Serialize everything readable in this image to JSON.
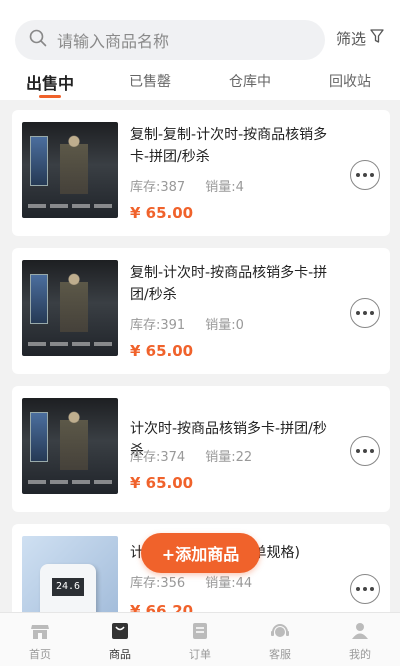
{
  "search": {
    "placeholder": "请输入商品名称"
  },
  "filter": {
    "label": "筛选"
  },
  "tabs": [
    {
      "label": "出售中"
    },
    {
      "label": "已售罄"
    },
    {
      "label": "仓库中"
    },
    {
      "label": "回收站"
    }
  ],
  "labels": {
    "stock": "库存:",
    "sales": "销量:"
  },
  "products": [
    {
      "title": "复制-复制-计次时-按商品核销多卡-拼团/秒杀",
      "stock": "387",
      "sales": "4",
      "price": "¥ 65.00"
    },
    {
      "title": "复制-计次时-按商品核销多卡-拼团/秒杀",
      "stock": "391",
      "sales": "0",
      "price": "¥ 65.00"
    },
    {
      "title": "计次时-按商品核销多卡-拼团/秒杀",
      "stock": "374",
      "sales": "22",
      "price": "¥ 65.00"
    },
    {
      "title": "计次时-按商品核销(单规格)",
      "stock": "356",
      "sales": "44",
      "price": "¥ 66.20",
      "thumb_text": "24.6"
    }
  ],
  "add_button": {
    "label": "+添加商品"
  },
  "tabbar": [
    {
      "label": "首页",
      "icon": "shop-icon"
    },
    {
      "label": "商品",
      "icon": "bag-icon"
    },
    {
      "label": "订单",
      "icon": "order-icon"
    },
    {
      "label": "客服",
      "icon": "headset-icon"
    },
    {
      "label": "我的",
      "icon": "user-icon"
    }
  ],
  "colors": {
    "accent": "#f0622b",
    "background": "#f2f2f2"
  }
}
